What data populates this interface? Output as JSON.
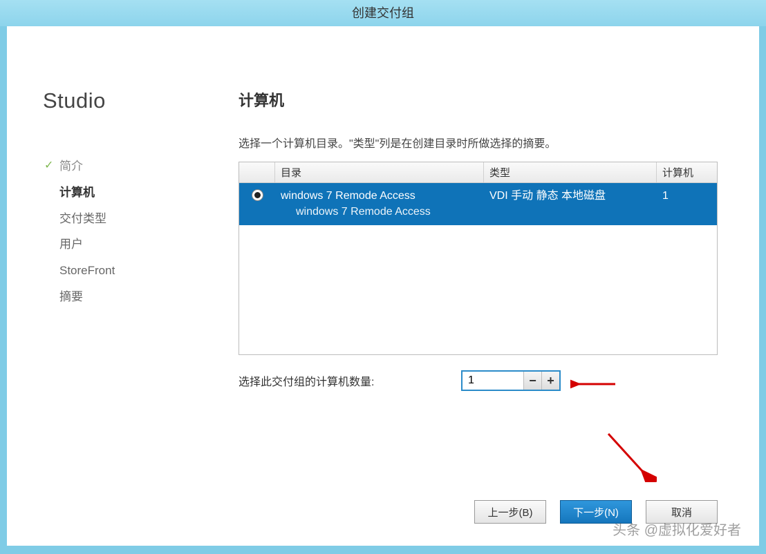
{
  "window": {
    "title": "创建交付组"
  },
  "sidebar": {
    "brand": "Studio",
    "nav": [
      {
        "label": "简介",
        "state": "completed"
      },
      {
        "label": "计算机",
        "state": "current"
      },
      {
        "label": "交付类型",
        "state": "pending"
      },
      {
        "label": "用户",
        "state": "pending"
      },
      {
        "label": "StoreFront",
        "state": "pending"
      },
      {
        "label": "摘要",
        "state": "pending"
      }
    ]
  },
  "main": {
    "heading": "计算机",
    "subtext": "选择一个计算机目录。\"类型\"列是在创建目录时所做选择的摘要。",
    "table": {
      "columns": {
        "directory": "目录",
        "type": "类型",
        "count": "计算机"
      },
      "row": {
        "dir_main": "windows 7 Remode Access",
        "dir_sub": "windows 7 Remode Access",
        "type": "VDI 手动 静态 本地磁盘",
        "count": "1",
        "selected": true
      }
    },
    "count_selector": {
      "label": "选择此交付组的计算机数量:",
      "value": "1"
    }
  },
  "buttons": {
    "back": "上一步(B)",
    "next": "下一步(N)",
    "cancel": "取消"
  },
  "watermark": "头条 @虚拟化爱好者"
}
